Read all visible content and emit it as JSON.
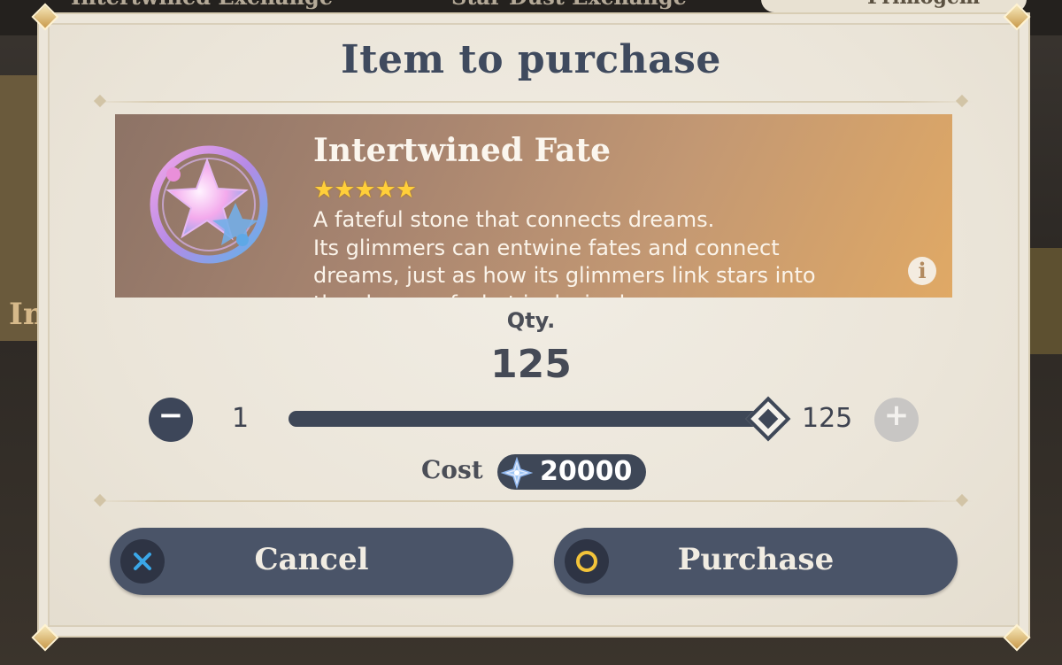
{
  "background": {
    "tab_left": "Intertwined Exchange",
    "tab_right": "Star Dust Exchange",
    "currency_label": "Primogem",
    "side_text": "In"
  },
  "dialog": {
    "title": "Item to purchase"
  },
  "item": {
    "name": "Intertwined Fate",
    "rarity_stars": 5,
    "stars_text": "★★★★★",
    "description_lines": [
      "A fateful stone that connects dreams.",
      "Its glimmers can entwine fates and connect",
      "dreams, just as how its glimmers link stars into",
      "the shapes of what is desired..."
    ],
    "info_icon": "i"
  },
  "quantity": {
    "label": "Qty.",
    "value": "125",
    "min": "1",
    "max": "125",
    "minus_symbol": "−",
    "plus_symbol": "+",
    "slider_fraction": 1.0
  },
  "cost": {
    "label": "Cost",
    "value": "20000",
    "currency_icon": "primogem-icon"
  },
  "buttons": {
    "cancel_label": "Cancel",
    "purchase_label": "Purchase"
  },
  "colors": {
    "title": "#3f4a5e",
    "button_bg": "#4a5468",
    "star": "#ffcf3a",
    "confirm_ring": "#f3c43a",
    "cancel_x": "#3aa7e8"
  }
}
